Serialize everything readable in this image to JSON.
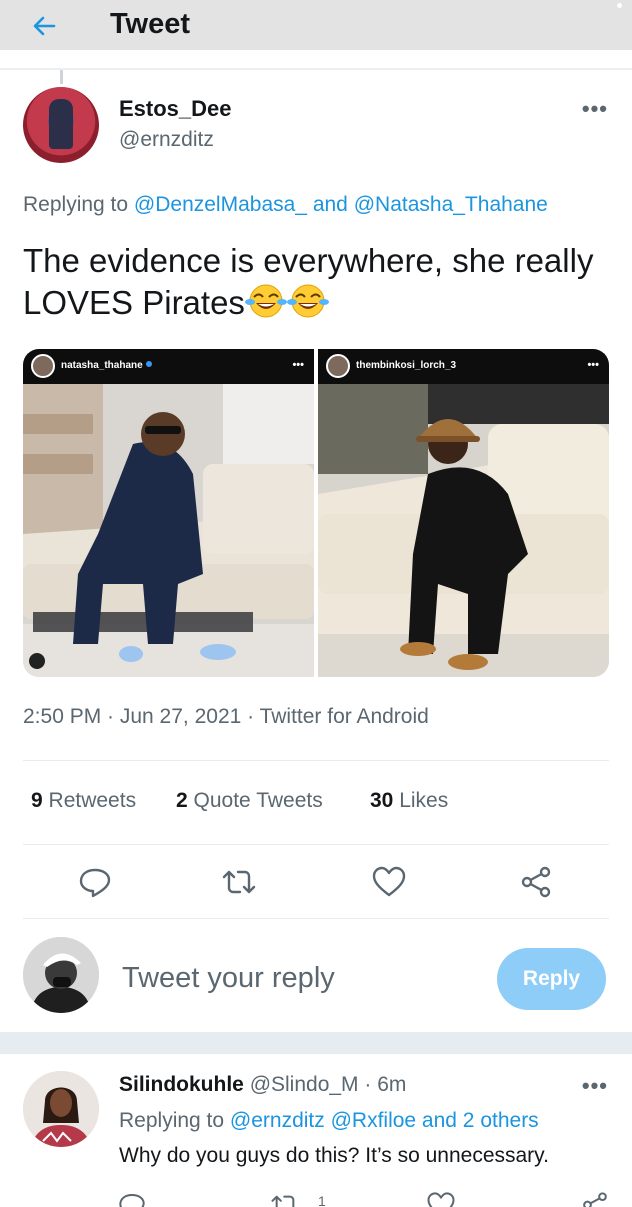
{
  "header": {
    "title": "Tweet",
    "back_icon": "arrow-left-icon"
  },
  "tweet": {
    "author_name": "Estos_Dee",
    "author_handle": "@ernzditz",
    "more_label": "•••",
    "replying_prefix": "Replying to",
    "reply_mention_1": "@DenzelMabasa_",
    "reply_and": "and",
    "reply_mention_2": "@Natasha_Thahane",
    "text": "The evidence is everywhere, she really LOVES Pirates",
    "emojis": [
      "face-with-tears-of-joy-icon",
      "face-with-tears-of-joy-icon"
    ],
    "media": {
      "left_username": "natasha_thahane",
      "right_username": "thembinkosi_lorch_3",
      "dots": "•••"
    },
    "timestamp": "2:50 PM · Jun 27, 2021 · Twitter for Android",
    "stats": {
      "retweets_count": "9",
      "retweets_label": "Retweets",
      "quote_count": "2",
      "quote_label": "Quote Tweets",
      "likes_count": "30",
      "likes_label": "Likes"
    },
    "actions": [
      "reply-icon",
      "retweet-icon",
      "like-icon",
      "share-icon"
    ]
  },
  "composer": {
    "placeholder": "Tweet your reply",
    "button_label": "Reply",
    "button_color": "#8ecdf7"
  },
  "reply": {
    "name": "Silindokuhle",
    "handle": "@Slindo_M",
    "time": "6m",
    "separator": "·",
    "more_label": "•••",
    "replying_prefix": "Replying to",
    "mentions": "@ernzditz @Rxfiloe and 2 others",
    "text": "Why do you guys do this? It’s so unnecessary.",
    "retweet_count": "1"
  },
  "colors": {
    "accent": "#1b95e0",
    "muted": "#5b6770",
    "text": "#14171a"
  }
}
